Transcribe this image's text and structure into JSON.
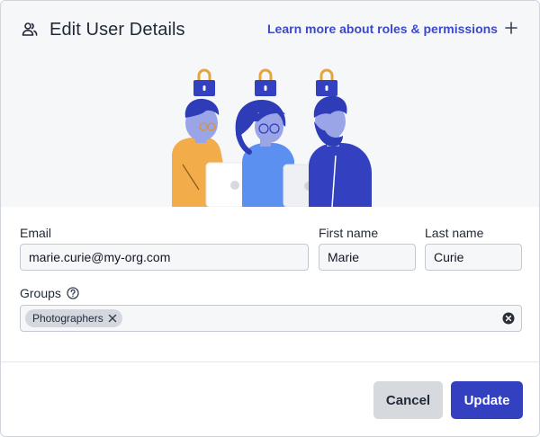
{
  "header": {
    "title": "Edit User Details",
    "title_icon": "users-icon",
    "learn_link": "Learn more about roles & permissions",
    "add_icon": "plus-icon"
  },
  "form": {
    "email": {
      "label": "Email",
      "value": "marie.curie@my-org.com"
    },
    "first_name": {
      "label": "First name",
      "value": "Marie"
    },
    "last_name": {
      "label": "Last name",
      "value": "Curie"
    },
    "groups": {
      "label": "Groups",
      "help_icon": "question-circle-icon",
      "chips": [
        "Photographers"
      ],
      "clear_icon": "clear-circle-icon"
    }
  },
  "footer": {
    "cancel_label": "Cancel",
    "update_label": "Update"
  },
  "colors": {
    "accent": "#3341c0",
    "link": "#3b49c5",
    "hero_background": "#f6f7f9",
    "lock": "#3341c0",
    "lock_shackle": "#e5a43c"
  }
}
